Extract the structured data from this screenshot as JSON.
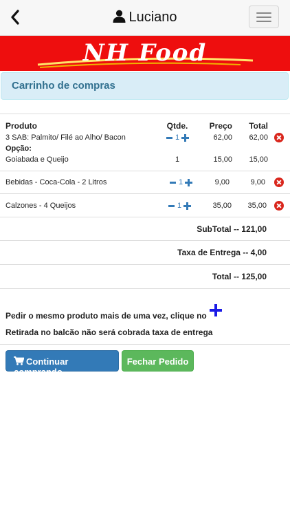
{
  "header": {
    "user_name": "Luciano",
    "back_icon": "chevron-left-icon",
    "user_icon": "user-icon",
    "menu_icon": "hamburger-icon"
  },
  "banner": {
    "logo_text": "NH Food",
    "color": "#ee0e0e"
  },
  "panel": {
    "title": "Carrinho de compras"
  },
  "table": {
    "headers": {
      "product": "Produto",
      "qty": "Qtde.",
      "price": "Preço",
      "total": "Total"
    },
    "rows": [
      {
        "product": "3 SAB: Palmito/ Filé ao Alho/ Bacon",
        "qty": "1",
        "price": "62,00",
        "total": "62,00",
        "option_label": "Opção:",
        "option_product": "Goiabada e Queijo",
        "option_qty": "1",
        "option_price": "15,00",
        "option_total": "15,00"
      },
      {
        "product": "Bebidas - Coca-Cola - 2 Litros",
        "qty": "1",
        "price": "9,00",
        "total": "9,00"
      },
      {
        "product": "Calzones - 4 Queijos",
        "qty": "1",
        "price": "35,00",
        "total": "35,00"
      }
    ]
  },
  "summary": {
    "subtotal": "SubTotal -- 121,00",
    "delivery": "Taxa de Entrega -- 4,00",
    "total": "Total -- 125,00"
  },
  "notes": {
    "repeat": "Pedir o mesmo produto mais de uma vez, clique no",
    "pickup": "Retirada no balcão não será cobrada taxa de entrega"
  },
  "buttons": {
    "continue": "Continuar comprando",
    "continue_icon": "shopping-cart-icon",
    "close": "Fechar Pedido"
  },
  "colors": {
    "primary": "#337ab7",
    "success": "#5cb85c",
    "danger": "#d9261c",
    "alert_bg": "#d9edf7"
  }
}
